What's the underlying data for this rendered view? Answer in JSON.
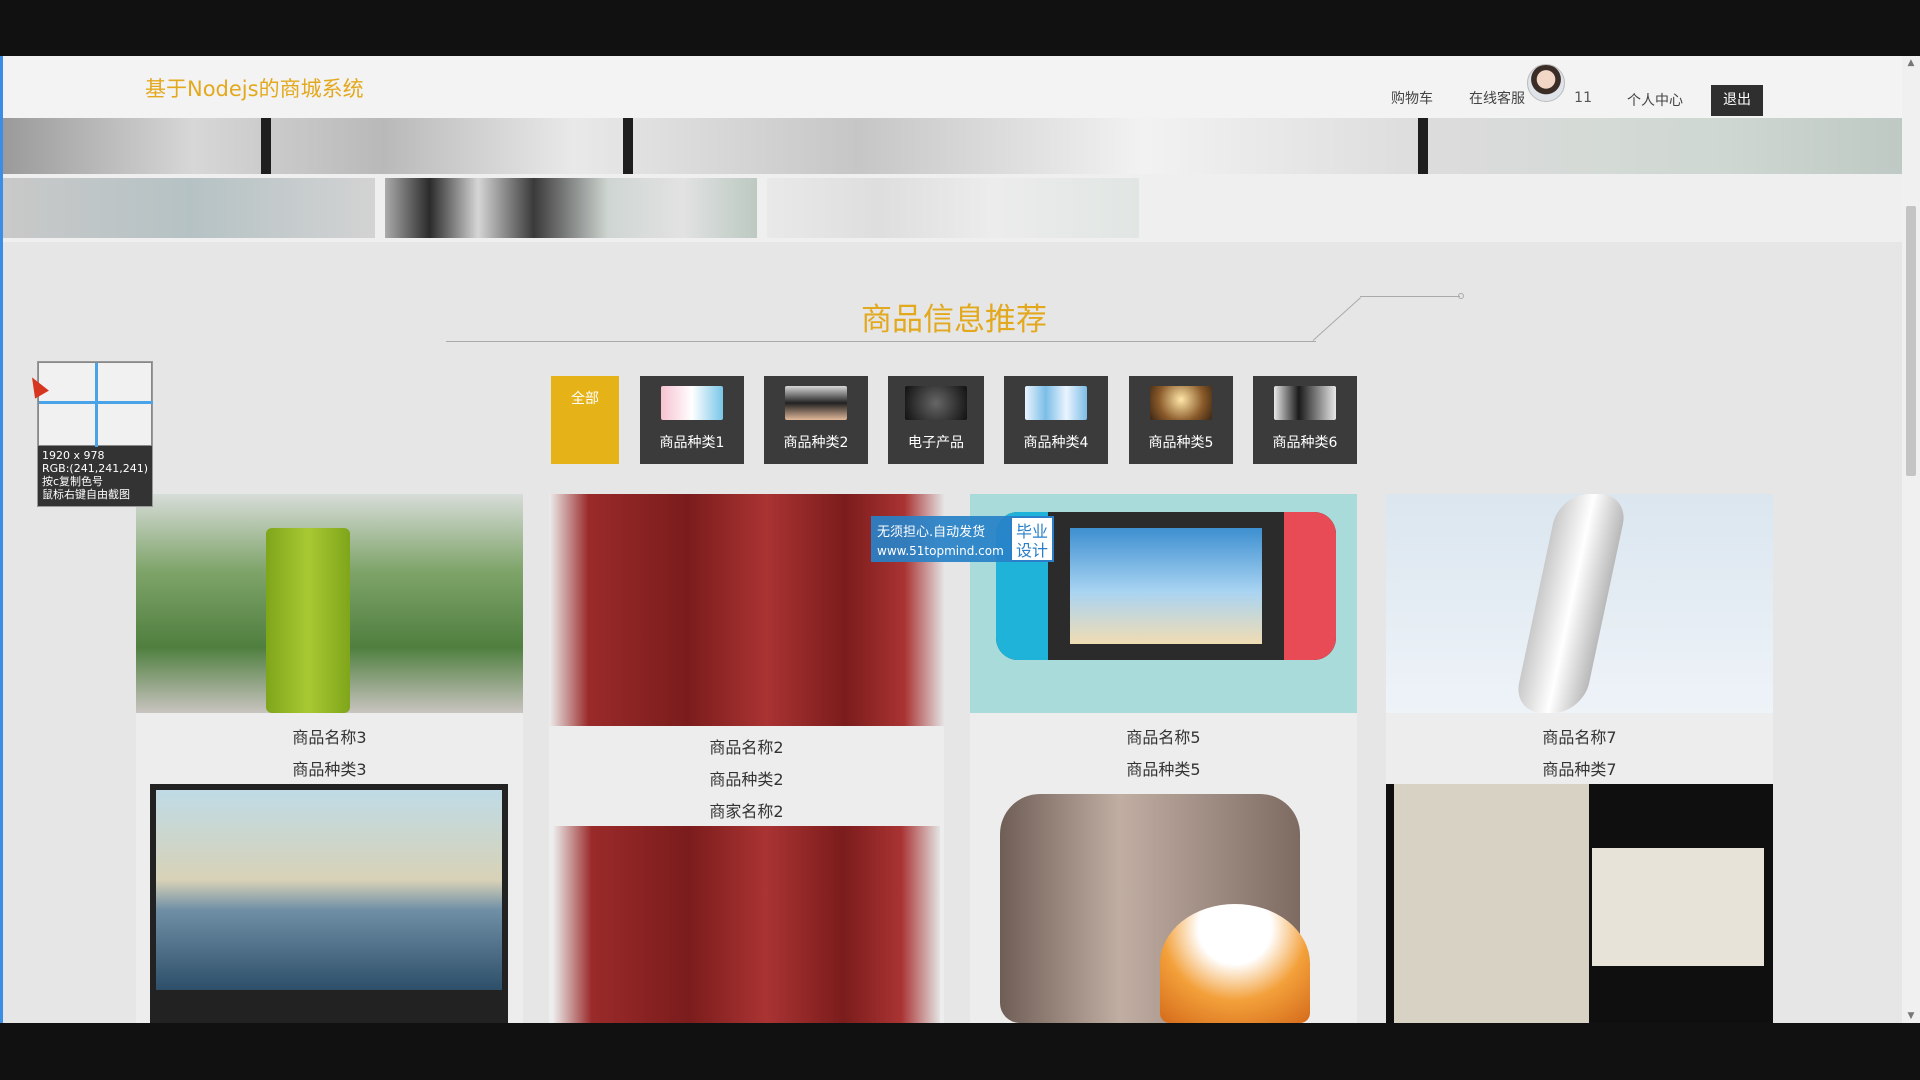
{
  "header": {
    "brand": "基于Nodejs的商城系统",
    "nav": [
      "购物车",
      "在线客服"
    ],
    "user_id": "11",
    "profile": "个人中心",
    "logout": "退出"
  },
  "section": {
    "title": "商品信息推荐"
  },
  "categories": [
    "全部",
    "商品种类1",
    "商品种类2",
    "电子产品",
    "商品种类4",
    "商品种类5",
    "商品种类6"
  ],
  "products": [
    {
      "name": "商品名称3",
      "type": "商品种类3"
    },
    {
      "name": "商品名称2",
      "type": "商品种类2",
      "merchant": "商家名称2"
    },
    {
      "name": "商品名称5",
      "type": "商品种类5"
    },
    {
      "name": "商品名称7",
      "type": "商品种类7"
    }
  ],
  "watermark": {
    "line1": "无须担心.自动发货",
    "line2": "www.51topmind.com",
    "badge": "毕业设计"
  },
  "picker": {
    "size": "1920 x 978",
    "rgb": "RGB:(241,241,241)",
    "hint1": "按c复制色号",
    "hint2": "鼠标右键自由截图"
  },
  "colors": {
    "accent": "#e3a91e",
    "dark_button": "#3b3b3b",
    "page_bg": "#e6e6e6"
  }
}
